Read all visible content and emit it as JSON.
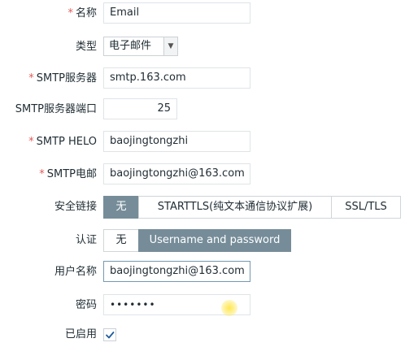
{
  "form": {
    "name": {
      "label": "名称",
      "value": "Email",
      "required": true
    },
    "type": {
      "label": "类型",
      "value": "电子邮件",
      "required": false
    },
    "smtp_server": {
      "label": "SMTP服务器",
      "value": "smtp.163.com",
      "required": true
    },
    "smtp_port": {
      "label": "SMTP服务器端口",
      "value": "25",
      "required": false
    },
    "smtp_helo": {
      "label": "SMTP HELO",
      "value": "baojingtongzhi",
      "required": true
    },
    "smtp_email": {
      "label": "SMTP电邮",
      "value": "baojingtongzhi@163.com",
      "required": true
    },
    "connection_security": {
      "label": "安全链接",
      "options": [
        "无",
        "STARTTLS(纯文本通信协议扩展)",
        "SSL/TLS"
      ],
      "selected": "无"
    },
    "authentication": {
      "label": "认证",
      "options": [
        "无",
        "Username and password"
      ],
      "selected": "Username and password"
    },
    "username": {
      "label": "用户名称",
      "value": "baojingtongzhi@163.com"
    },
    "password": {
      "label": "密码",
      "value": "•••••••"
    },
    "enabled": {
      "label": "已启用",
      "checked": true
    }
  },
  "required_mark": "*",
  "colors": {
    "required": "#e45959",
    "segment_active": "#768d99",
    "field_border": "#dfe4e7",
    "checkmark": "#1f5c9e"
  }
}
